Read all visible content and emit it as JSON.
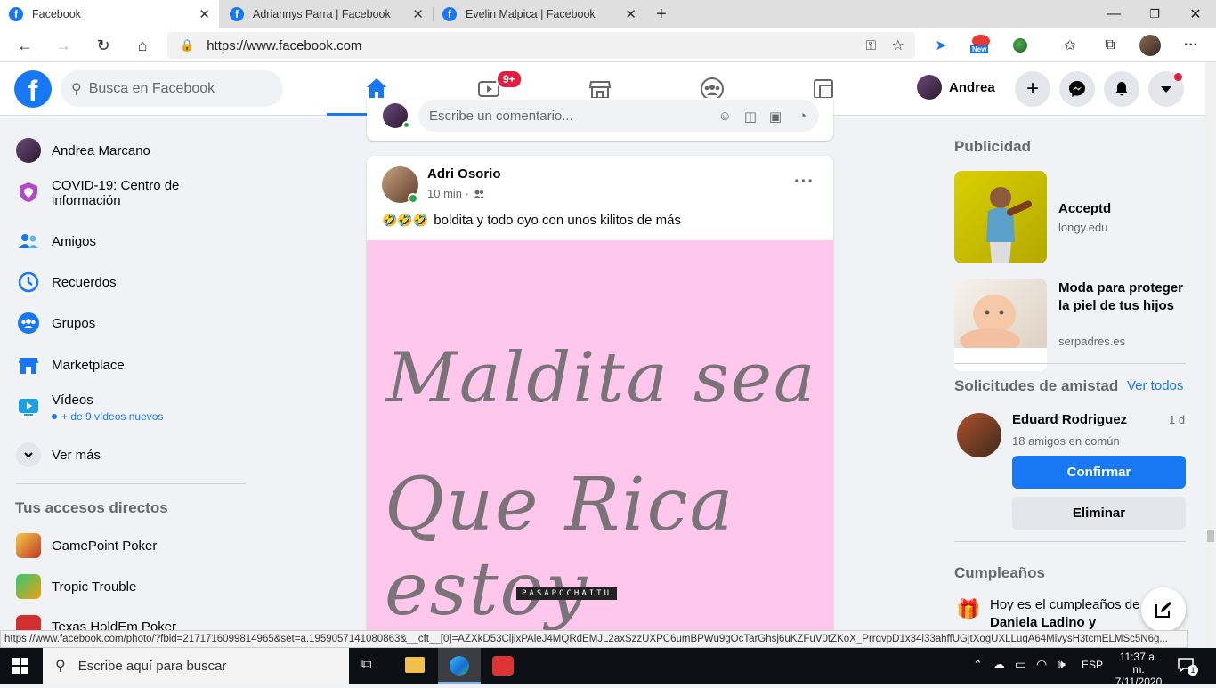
{
  "browser": {
    "tabs": [
      {
        "title": "Facebook",
        "active": true
      },
      {
        "title": "Adriannys Parra | Facebook",
        "active": false
      },
      {
        "title": "Evelin Malpica | Facebook",
        "active": false
      }
    ],
    "url": "https://www.facebook.com",
    "status_url": "https://www.facebook.com/photo/?fbid=2171716099814965&set=a.1959057141080863&__cft__[0]=AZXkD53CijixPAleJ4MQRdEMJL2axSzzUXPC6umBPWu9gOcTarGhsj6uKZFuV0tZKoX_PrrqvpD1x34i33ahffUGjtXogUXLLugA64MivysH3tcmELMSc5N6g...",
    "new_badge": "New"
  },
  "header": {
    "logo": "f",
    "search_placeholder": "Busca en Facebook",
    "watch_badge": "9+",
    "user_name": "Andrea",
    "accent": "#1877f2"
  },
  "sidebar": {
    "items": [
      {
        "label": "Andrea Marcano",
        "icon": "avatar"
      },
      {
        "label": "COVID-19: Centro de",
        "label2": "información",
        "icon": "covid-icon"
      },
      {
        "label": "Amigos",
        "icon": "friends-icon"
      },
      {
        "label": "Recuerdos",
        "icon": "memories-icon"
      },
      {
        "label": "Grupos",
        "icon": "groups-icon"
      },
      {
        "label": "Marketplace",
        "icon": "marketplace-icon"
      },
      {
        "label": "Vídeos",
        "sub": "+ de 9 vídeos nuevos",
        "icon": "video-icon"
      },
      {
        "label": "Ver más",
        "icon": "chevron-down-icon"
      }
    ],
    "shortcuts_title": "Tus accesos directos",
    "shortcuts": [
      {
        "label": "GamePoint Poker"
      },
      {
        "label": "Tropic Trouble"
      },
      {
        "label": "Texas HoldEm Poker"
      }
    ]
  },
  "feed": {
    "comment_placeholder": "Escribe un comentario...",
    "post": {
      "author": "Adri Osorio",
      "time": "10 min ·",
      "text": "boldita y todo oyo con unos kilitos de más",
      "emoji": "🤣🤣🤣",
      "image_line1": "Maldita sea",
      "image_line2": "Que Rica estoy",
      "image_watermark": "PASAPOCHAITU",
      "image_bg": "#fec7eb"
    }
  },
  "right": {
    "ads_title": "Publicidad",
    "ads": [
      {
        "title": "Acceptd",
        "domain": "longy.edu"
      },
      {
        "title": "Moda para proteger la piel de tus hijos",
        "domain": "serpadres.es"
      }
    ],
    "requests_title": "Solicitudes de amistad",
    "see_all": "Ver todos",
    "request": {
      "name": "Eduard Rodriguez",
      "age": "1 d",
      "mutual": "18 amigos en común",
      "confirm": "Confirmar",
      "delete": "Eliminar"
    },
    "birthdays_title": "Cumpleaños",
    "birthday_text": "Hoy es el cumpleaños de",
    "birthday_name": "Daniela Ladino y"
  },
  "taskbar": {
    "search": "Escribe aquí para buscar",
    "lang": "ESP",
    "time": "11:37 a. m.",
    "date": "7/11/2020",
    "notif_count": "1"
  }
}
